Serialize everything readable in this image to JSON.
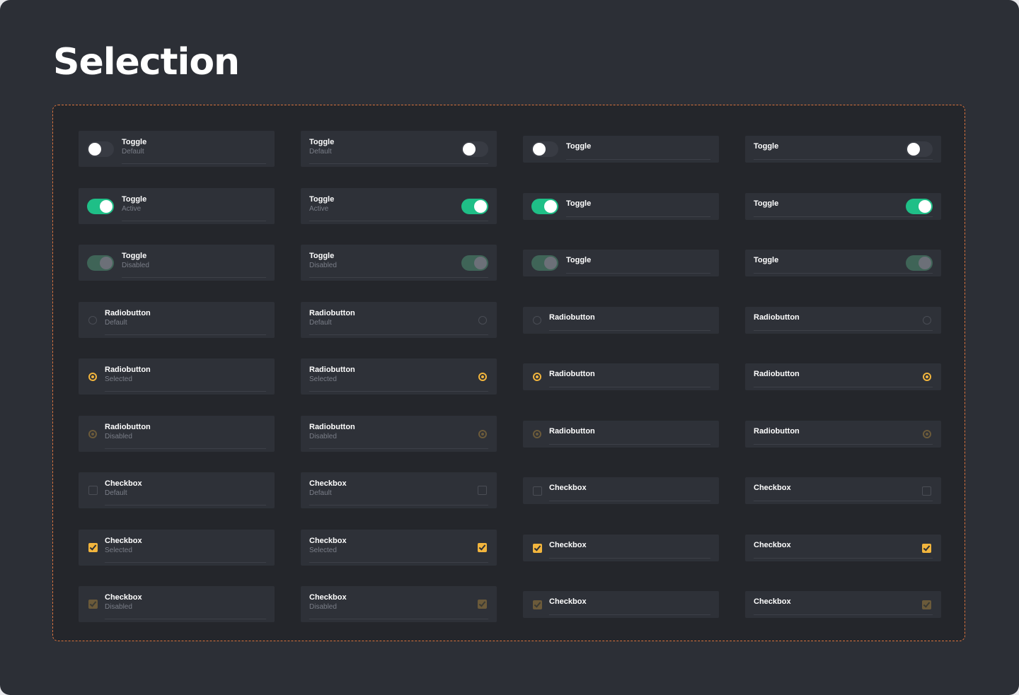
{
  "page": {
    "title": "Selection"
  },
  "colors": {
    "background": "#2c2f36",
    "panel": "#24262b",
    "card": "#2e3138",
    "accent_green": "#1fbf87",
    "accent_yellow": "#f2b53d",
    "dashed_border": "#d9733f"
  },
  "rows": [
    {
      "type": "toggle",
      "state": "default",
      "label": "Toggle",
      "sub": "Default"
    },
    {
      "type": "toggle",
      "state": "active",
      "label": "Toggle",
      "sub": "Active"
    },
    {
      "type": "toggle",
      "state": "disabled",
      "label": "Toggle",
      "sub": "Disabled"
    },
    {
      "type": "radio",
      "state": "default",
      "label": "Radiobutton",
      "sub": "Default"
    },
    {
      "type": "radio",
      "state": "selected",
      "label": "Radiobutton",
      "sub": "Selected"
    },
    {
      "type": "radio",
      "state": "disabled",
      "label": "Radiobutton",
      "sub": "Disabled"
    },
    {
      "type": "checkbox",
      "state": "default",
      "label": "Checkbox",
      "sub": "Default"
    },
    {
      "type": "checkbox",
      "state": "selected",
      "label": "Checkbox",
      "sub": "Selected"
    },
    {
      "type": "checkbox",
      "state": "disabled",
      "label": "Checkbox",
      "sub": "Disabled"
    }
  ],
  "columns": [
    {
      "control_side": "left",
      "shows_sub": true
    },
    {
      "control_side": "right",
      "shows_sub": true
    },
    {
      "control_side": "left",
      "shows_sub": false
    },
    {
      "control_side": "right",
      "shows_sub": false
    }
  ]
}
